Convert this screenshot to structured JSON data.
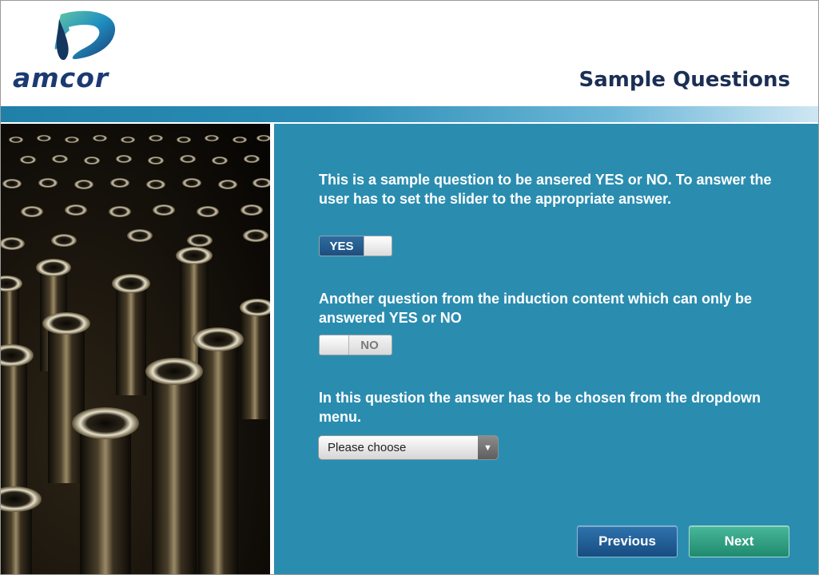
{
  "header": {
    "logo_text": "amcor",
    "title": "Sample Questions"
  },
  "colors": {
    "brand_blue": "#1b3a73",
    "content_bg": "#2a8db0",
    "previous_button": "#1f5d94",
    "next_button": "#2ea283"
  },
  "questions": [
    {
      "text": "This is a sample question to be ansered YES or NO. To answer the user has to set the slider to the appropriate answer.",
      "control": "toggle",
      "label": "YES"
    },
    {
      "text": "Another question from the induction content which can only be answered YES or NO",
      "control": "toggle",
      "label": "NO"
    },
    {
      "text": "In this question the answer has to be chosen from the dropdown menu.",
      "control": "dropdown",
      "label": "Please choose"
    }
  ],
  "nav": {
    "previous_label": "Previous",
    "next_label": "Next"
  },
  "icons": {
    "logo": "amcor-logo-icon",
    "dropdown": "chevron-down-icon"
  }
}
